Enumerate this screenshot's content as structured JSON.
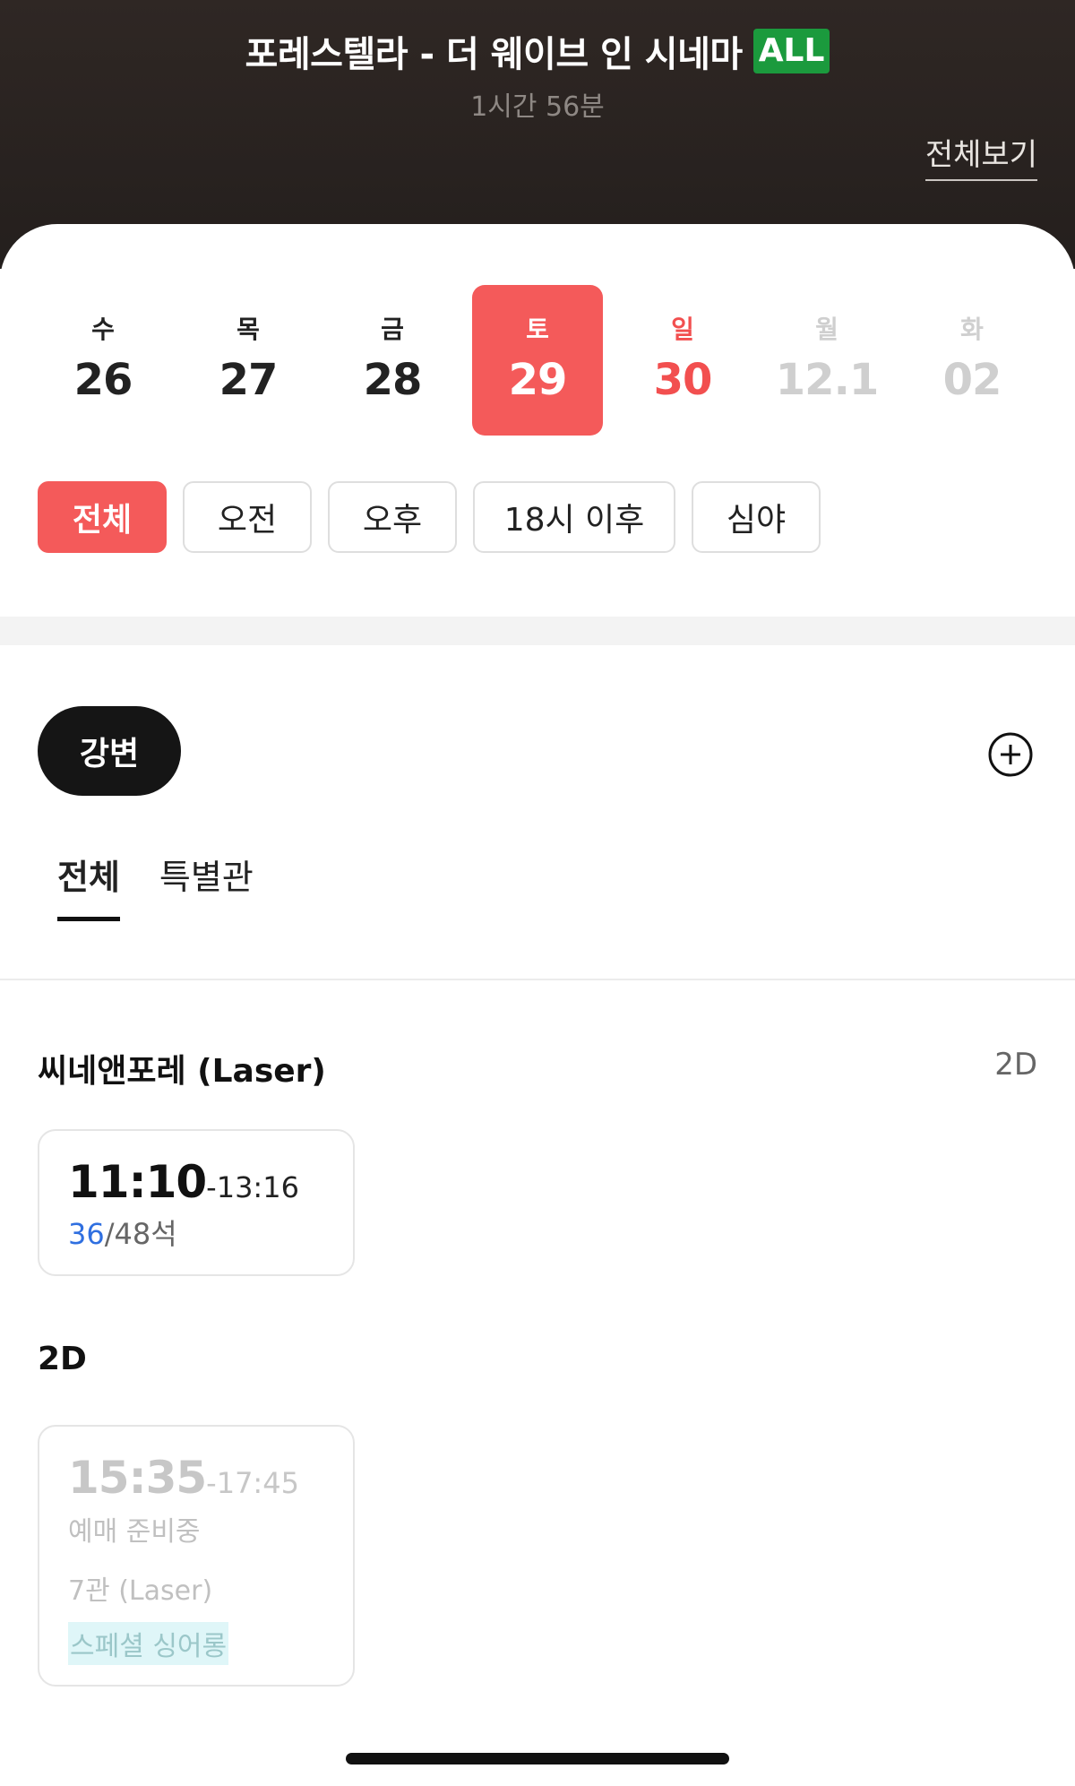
{
  "header": {
    "movie_title": "포레스텔라 - 더 웨이브 인 시네마",
    "rating_badge": "ALL",
    "runtime": "1시간 56분",
    "view_all": "전체보기"
  },
  "dates": [
    {
      "dow": "수",
      "num": "26",
      "state": "normal"
    },
    {
      "dow": "목",
      "num": "27",
      "state": "normal"
    },
    {
      "dow": "금",
      "num": "28",
      "state": "normal"
    },
    {
      "dow": "토",
      "num": "29",
      "state": "selected"
    },
    {
      "dow": "일",
      "num": "30",
      "state": "sunday"
    },
    {
      "dow": "월",
      "num": "12.1",
      "state": "disabled"
    },
    {
      "dow": "화",
      "num": "02",
      "state": "disabled"
    }
  ],
  "time_filters": [
    {
      "label": "전체",
      "active": true
    },
    {
      "label": "오전",
      "active": false
    },
    {
      "label": "오후",
      "active": false
    },
    {
      "label": "18시 이후",
      "active": false
    },
    {
      "label": "심야",
      "active": false
    }
  ],
  "region": {
    "label": "강변",
    "add_icon": "plus-circle-icon"
  },
  "tabs": [
    {
      "label": "전체",
      "active": true
    },
    {
      "label": "특별관",
      "active": false
    }
  ],
  "sections": [
    {
      "title": "씨네앤포레 (Laser)",
      "format": "2D",
      "showtime": {
        "start": "11:10",
        "end": "-13:16",
        "seats_available": "36",
        "seats_total": "/48석"
      }
    },
    {
      "title": "2D",
      "showtime": {
        "start": "15:35",
        "end": "-17:45",
        "status": "예매 준비중",
        "hall": "7관 (Laser)",
        "tag": "스페셜 싱어롱"
      }
    }
  ],
  "colors": {
    "accent": "#f45a5a",
    "seats_blue": "#2f6fe0",
    "rating_green": "#1b9a3d"
  }
}
